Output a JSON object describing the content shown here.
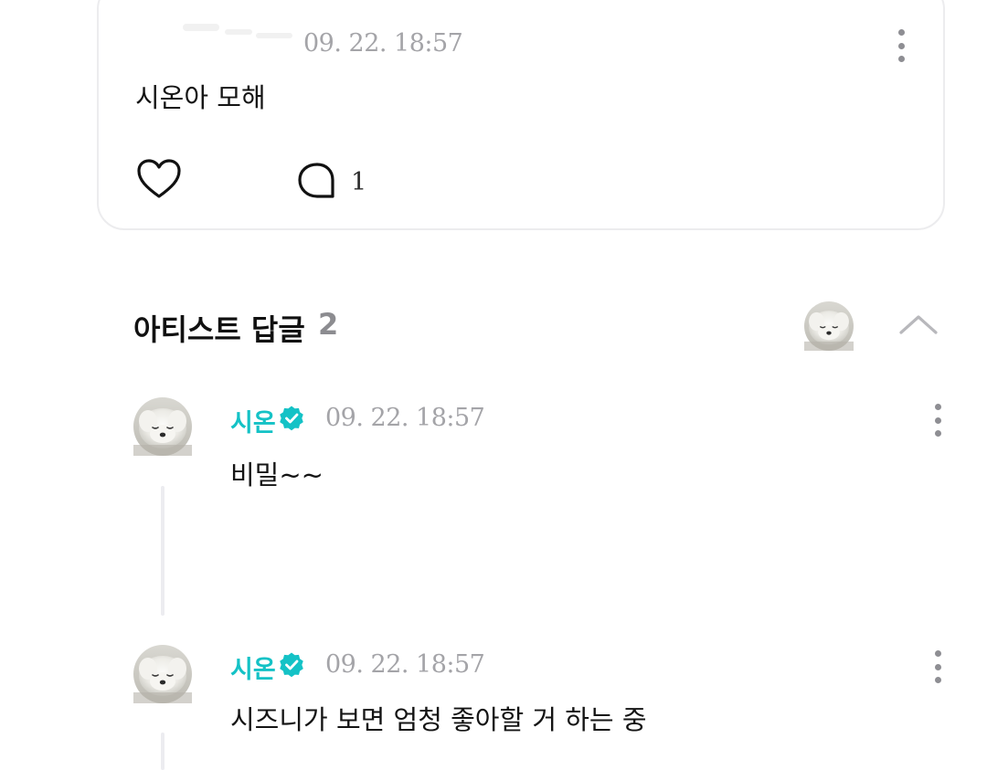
{
  "post": {
    "timestamp": "09. 22. 18:57",
    "body": "시온아 모해",
    "comment_count": "1",
    "icons": {
      "like": "heart-outline-icon",
      "comment": "speech-bubble-icon",
      "more": "more-vertical-icon"
    }
  },
  "artist_replies": {
    "title": "아티스트 답글",
    "count": "2",
    "icons": {
      "collapse": "chevron-up-icon"
    }
  },
  "replies": [
    {
      "author": "시온",
      "verified": true,
      "timestamp": "09. 22. 18:57",
      "text": "비밀~~"
    },
    {
      "author": "시온",
      "verified": true,
      "timestamp": "09. 22. 18:57",
      "text": "시즈니가 보면 엄청 좋아할 거 하는 중"
    }
  ],
  "colors": {
    "accent": "#14c2c6",
    "muted_text": "#a4a4a8",
    "card_border": "#ececee",
    "thread_line": "#ececf0"
  }
}
